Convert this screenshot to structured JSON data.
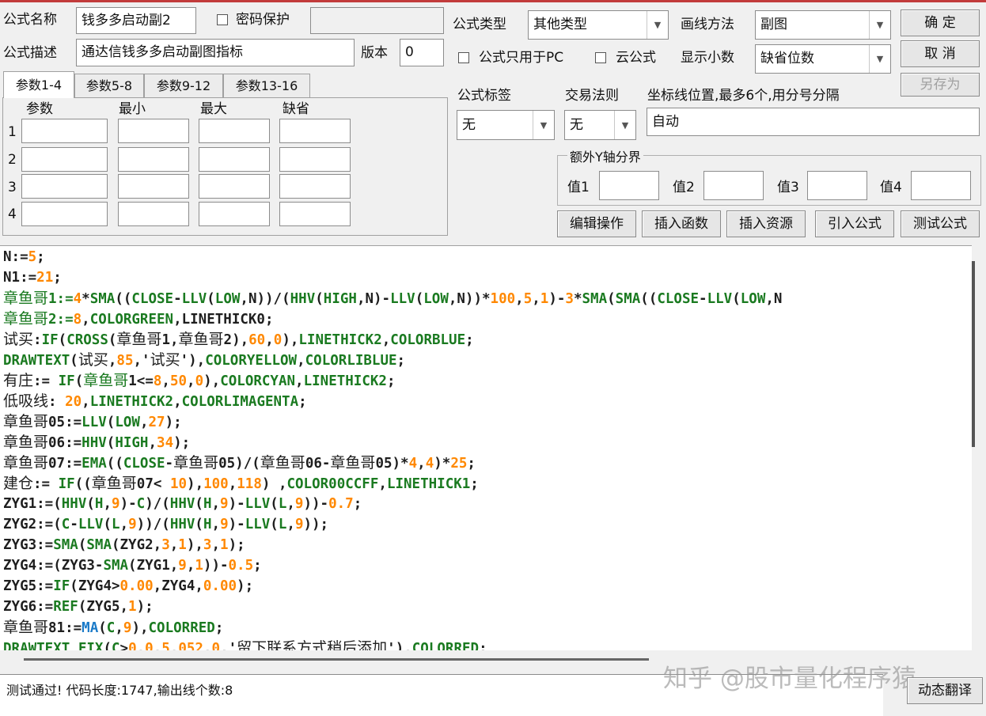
{
  "form": {
    "name_label": "公式名称",
    "name_value": "钱多多启动副2",
    "password_label": "密码保护",
    "password_value": "",
    "desc_label": "公式描述",
    "desc_value": "通达信钱多多启动副图指标",
    "version_label": "版本",
    "version_value": "0",
    "type_label": "公式类型",
    "type_value": "其他类型",
    "draw_label": "画线方法",
    "draw_value": "副图",
    "pc_only_label": "公式只用于PC",
    "cloud_label": "云公式",
    "decimal_label": "显示小数",
    "decimal_value": "缺省位数",
    "tag_label": "公式标签",
    "tag_value": "无",
    "rule_label": "交易法则",
    "rule_value": "无",
    "coord_label": "坐标线位置,最多6个,用分号分隔",
    "coord_value": "自动",
    "yaxis_title": "额外Y轴分界",
    "yaxis_values": [
      "值1",
      "值2",
      "值3",
      "值4"
    ]
  },
  "buttons": {
    "ok": "确  定",
    "cancel": "取  消",
    "saveas": "另存为",
    "edit_ops": "编辑操作",
    "insert_func": "插入函数",
    "insert_res": "插入资源",
    "import_formula": "引入公式",
    "test_formula": "测试公式",
    "dynamic_translate": "动态翻译"
  },
  "param_tabs": [
    "参数1-4",
    "参数5-8",
    "参数9-12",
    "参数13-16"
  ],
  "param_headers": [
    "参数",
    "最小",
    "最大",
    "缺省"
  ],
  "param_rows": [
    "1",
    "2",
    "3",
    "4"
  ],
  "code_lines": [
    [
      [
        "k",
        "N:="
      ],
      [
        "n",
        "5"
      ],
      [
        "k",
        ";"
      ]
    ],
    [
      [
        "k",
        "N1:="
      ],
      [
        "n",
        "21"
      ],
      [
        "k",
        ";"
      ]
    ],
    [
      [
        "fz",
        "章鱼哥"
      ],
      [
        "f",
        "1:="
      ],
      [
        "n",
        "4"
      ],
      [
        "k",
        "*"
      ],
      [
        "f",
        "SMA"
      ],
      [
        "k",
        "(("
      ],
      [
        "f",
        "CLOSE"
      ],
      [
        "k",
        "-"
      ],
      [
        "f",
        "LLV"
      ],
      [
        "k",
        "("
      ],
      [
        "f",
        "LOW"
      ],
      [
        "k",
        ",N))/("
      ],
      [
        "f",
        "HHV"
      ],
      [
        "k",
        "("
      ],
      [
        "f",
        "HIGH"
      ],
      [
        "k",
        ",N)-"
      ],
      [
        "f",
        "LLV"
      ],
      [
        "k",
        "("
      ],
      [
        "f",
        "LOW"
      ],
      [
        "k",
        ",N))*"
      ],
      [
        "n",
        "100"
      ],
      [
        "k",
        ","
      ],
      [
        "n",
        "5"
      ],
      [
        "k",
        ","
      ],
      [
        "n",
        "1"
      ],
      [
        "k",
        ")-"
      ],
      [
        "n",
        "3"
      ],
      [
        "k",
        "*"
      ],
      [
        "f",
        "SMA"
      ],
      [
        "k",
        "("
      ],
      [
        "f",
        "SMA"
      ],
      [
        "k",
        "(("
      ],
      [
        "f",
        "CLOSE"
      ],
      [
        "k",
        "-"
      ],
      [
        "f",
        "LLV"
      ],
      [
        "k",
        "("
      ],
      [
        "f",
        "LOW"
      ],
      [
        "k",
        ",N"
      ]
    ],
    [
      [
        "fz",
        "章鱼哥"
      ],
      [
        "f",
        "2:="
      ],
      [
        "n",
        "8"
      ],
      [
        "k",
        ","
      ],
      [
        "f",
        "COLORGREEN"
      ],
      [
        "k",
        ",LINETHICK0;"
      ]
    ],
    [
      [
        "kz",
        "试买"
      ],
      [
        "k",
        ":"
      ],
      [
        "f",
        "IF"
      ],
      [
        "k",
        "("
      ],
      [
        "f",
        "CROSS"
      ],
      [
        "k",
        "("
      ],
      [
        "kz",
        "章鱼哥"
      ],
      [
        "k",
        "1,"
      ],
      [
        "kz",
        "章鱼哥"
      ],
      [
        "k",
        "2),"
      ],
      [
        "n",
        "60"
      ],
      [
        "k",
        ","
      ],
      [
        "n",
        "0"
      ],
      [
        "k",
        "),"
      ],
      [
        "f",
        "LINETHICK2"
      ],
      [
        "k",
        ","
      ],
      [
        "f",
        "COLORBLUE"
      ],
      [
        "k",
        ";"
      ]
    ],
    [
      [
        "f",
        "DRAWTEXT"
      ],
      [
        "k",
        "("
      ],
      [
        "kz",
        "试买"
      ],
      [
        "k",
        ","
      ],
      [
        "n",
        "85"
      ],
      [
        "k",
        ",'"
      ],
      [
        "kz",
        "试买"
      ],
      [
        "k",
        "'),"
      ],
      [
        "f",
        "COLORYELLOW"
      ],
      [
        "k",
        ","
      ],
      [
        "f",
        "COLORLIBLUE"
      ],
      [
        "k",
        ";"
      ]
    ],
    [
      [
        "kz",
        "有庄"
      ],
      [
        "k",
        ":= "
      ],
      [
        "f",
        "IF"
      ],
      [
        "k",
        "("
      ],
      [
        "fz",
        "章鱼哥"
      ],
      [
        "k",
        "1<="
      ],
      [
        "n",
        "8"
      ],
      [
        "k",
        ","
      ],
      [
        "n",
        "50"
      ],
      [
        "k",
        ","
      ],
      [
        "n",
        "0"
      ],
      [
        "k",
        "),"
      ],
      [
        "f",
        "COLORCYAN"
      ],
      [
        "k",
        ","
      ],
      [
        "f",
        "LINETHICK2"
      ],
      [
        "k",
        ";"
      ]
    ],
    [
      [
        "kz",
        "低吸线"
      ],
      [
        "k",
        ": "
      ],
      [
        "n",
        "20"
      ],
      [
        "k",
        ","
      ],
      [
        "f",
        "LINETHICK2"
      ],
      [
        "k",
        ","
      ],
      [
        "f",
        "COLORLIMAGENTA"
      ],
      [
        "k",
        ";"
      ]
    ],
    [
      [
        "kz",
        "章鱼哥"
      ],
      [
        "k",
        "05:="
      ],
      [
        "f",
        "LLV"
      ],
      [
        "k",
        "("
      ],
      [
        "f",
        "LOW"
      ],
      [
        "k",
        ","
      ],
      [
        "n",
        "27"
      ],
      [
        "k",
        ");"
      ]
    ],
    [
      [
        "kz",
        "章鱼哥"
      ],
      [
        "k",
        "06:="
      ],
      [
        "f",
        "HHV"
      ],
      [
        "k",
        "("
      ],
      [
        "f",
        "HIGH"
      ],
      [
        "k",
        ","
      ],
      [
        "n",
        "34"
      ],
      [
        "k",
        ");"
      ]
    ],
    [
      [
        "kz",
        "章鱼哥"
      ],
      [
        "k",
        "07:="
      ],
      [
        "f",
        "EMA"
      ],
      [
        "k",
        "(("
      ],
      [
        "f",
        "CLOSE"
      ],
      [
        "k",
        "-"
      ],
      [
        "kz",
        "章鱼哥"
      ],
      [
        "k",
        "05)/("
      ],
      [
        "kz",
        "章鱼哥"
      ],
      [
        "k",
        "06-"
      ],
      [
        "kz",
        "章鱼哥"
      ],
      [
        "k",
        "05)*"
      ],
      [
        "n",
        "4"
      ],
      [
        "k",
        ","
      ],
      [
        "n",
        "4"
      ],
      [
        "k",
        ")*"
      ],
      [
        "n",
        "25"
      ],
      [
        "k",
        ";"
      ]
    ],
    [
      [
        "kz",
        "建仓"
      ],
      [
        "k",
        ":= "
      ],
      [
        "f",
        "IF"
      ],
      [
        "k",
        "(("
      ],
      [
        "kz",
        "章鱼哥"
      ],
      [
        "k",
        "07< "
      ],
      [
        "n",
        "10"
      ],
      [
        "k",
        "),"
      ],
      [
        "n",
        "100"
      ],
      [
        "k",
        ","
      ],
      [
        "n",
        "118"
      ],
      [
        "k",
        ") ,"
      ],
      [
        "f",
        "COLOR00CCFF"
      ],
      [
        "k",
        ","
      ],
      [
        "f",
        "LINETHICK1"
      ],
      [
        "k",
        ";"
      ]
    ],
    [
      [
        "k",
        "ZYG1:=("
      ],
      [
        "f",
        "HHV"
      ],
      [
        "k",
        "("
      ],
      [
        "f",
        "H"
      ],
      [
        "k",
        ","
      ],
      [
        "n",
        "9"
      ],
      [
        "k",
        ")-"
      ],
      [
        "f",
        "C"
      ],
      [
        "k",
        ")/("
      ],
      [
        "f",
        "HHV"
      ],
      [
        "k",
        "("
      ],
      [
        "f",
        "H"
      ],
      [
        "k",
        ","
      ],
      [
        "n",
        "9"
      ],
      [
        "k",
        ")-"
      ],
      [
        "f",
        "LLV"
      ],
      [
        "k",
        "("
      ],
      [
        "f",
        "L"
      ],
      [
        "k",
        ","
      ],
      [
        "n",
        "9"
      ],
      [
        "k",
        "))-"
      ],
      [
        "n",
        "0.7"
      ],
      [
        "k",
        ";"
      ]
    ],
    [
      [
        "k",
        "ZYG2:=("
      ],
      [
        "f",
        "C"
      ],
      [
        "k",
        "-"
      ],
      [
        "f",
        "LLV"
      ],
      [
        "k",
        "("
      ],
      [
        "f",
        "L"
      ],
      [
        "k",
        ","
      ],
      [
        "n",
        "9"
      ],
      [
        "k",
        "))/("
      ],
      [
        "f",
        "HHV"
      ],
      [
        "k",
        "("
      ],
      [
        "f",
        "H"
      ],
      [
        "k",
        ","
      ],
      [
        "n",
        "9"
      ],
      [
        "k",
        ")-"
      ],
      [
        "f",
        "LLV"
      ],
      [
        "k",
        "("
      ],
      [
        "f",
        "L"
      ],
      [
        "k",
        ","
      ],
      [
        "n",
        "9"
      ],
      [
        "k",
        "));"
      ]
    ],
    [
      [
        "k",
        "ZYG3:="
      ],
      [
        "f",
        "SMA"
      ],
      [
        "k",
        "("
      ],
      [
        "f",
        "SMA"
      ],
      [
        "k",
        "(ZYG2,"
      ],
      [
        "n",
        "3"
      ],
      [
        "k",
        ","
      ],
      [
        "n",
        "1"
      ],
      [
        "k",
        "),"
      ],
      [
        "n",
        "3"
      ],
      [
        "k",
        ","
      ],
      [
        "n",
        "1"
      ],
      [
        "k",
        ");"
      ]
    ],
    [
      [
        "k",
        "ZYG4:=(ZYG3-"
      ],
      [
        "f",
        "SMA"
      ],
      [
        "k",
        "(ZYG1,"
      ],
      [
        "n",
        "9"
      ],
      [
        "k",
        ","
      ],
      [
        "n",
        "1"
      ],
      [
        "k",
        "))-"
      ],
      [
        "n",
        "0.5"
      ],
      [
        "k",
        ";"
      ]
    ],
    [
      [
        "k",
        "ZYG5:="
      ],
      [
        "f",
        "IF"
      ],
      [
        "k",
        "(ZYG4>"
      ],
      [
        "n",
        "0.00"
      ],
      [
        "k",
        ",ZYG4,"
      ],
      [
        "n",
        "0.00"
      ],
      [
        "k",
        ");"
      ]
    ],
    [
      [
        "k",
        "ZYG6:="
      ],
      [
        "f",
        "REF"
      ],
      [
        "k",
        "(ZYG5,"
      ],
      [
        "n",
        "1"
      ],
      [
        "k",
        ");"
      ]
    ],
    [
      [
        "kz",
        "章鱼哥"
      ],
      [
        "k",
        "81:="
      ],
      [
        "b",
        "MA"
      ],
      [
        "k",
        "("
      ],
      [
        "f",
        "C"
      ],
      [
        "k",
        ","
      ],
      [
        "n",
        "9"
      ],
      [
        "k",
        "),"
      ],
      [
        "f",
        "COLORRED"
      ],
      [
        "k",
        ";"
      ]
    ],
    [
      [
        "f",
        "DRAWTEXT_FIX"
      ],
      [
        "k",
        "("
      ],
      [
        "f",
        "C"
      ],
      [
        "k",
        ">"
      ],
      [
        "n",
        "0"
      ],
      [
        "k",
        "."
      ],
      [
        "n",
        "0"
      ],
      [
        "k",
        "."
      ],
      [
        "n",
        "5"
      ],
      [
        "k",
        "."
      ],
      [
        "n",
        "052"
      ],
      [
        "k",
        "."
      ],
      [
        "n",
        "0"
      ],
      [
        "k",
        ".'"
      ],
      [
        "kz",
        "留下联系方式稍后添加"
      ],
      [
        "k",
        "')."
      ],
      [
        "f",
        "COLORRED"
      ],
      [
        "k",
        ":"
      ]
    ]
  ],
  "status_text": "测试通过! 代码长度:1747,输出线个数:8",
  "watermark": "知乎 @股市量化程序猿"
}
